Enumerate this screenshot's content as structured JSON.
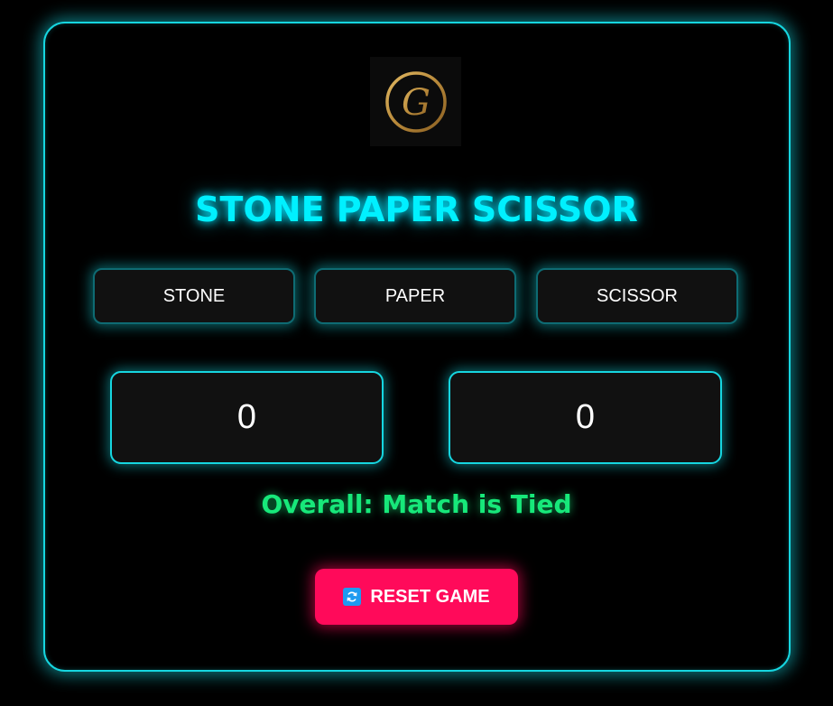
{
  "logo": {
    "letter": "G",
    "icon": "g-monogram-logo",
    "ring_color": "#b8893a"
  },
  "title": "STONE PAPER SCISSOR",
  "choices": [
    {
      "label": "STONE"
    },
    {
      "label": "PAPER"
    },
    {
      "label": "SCISSOR"
    }
  ],
  "scores": {
    "user": "0",
    "computer": "0"
  },
  "result": "Overall: Match is Tied",
  "reset": {
    "label": "RESET GAME",
    "icon": "refresh-icon"
  },
  "colors": {
    "accent": "#16d6e0",
    "title": "#00f0ff",
    "result": "#17e87a",
    "reset_bg": "#ff0a5a",
    "background": "#000000"
  }
}
